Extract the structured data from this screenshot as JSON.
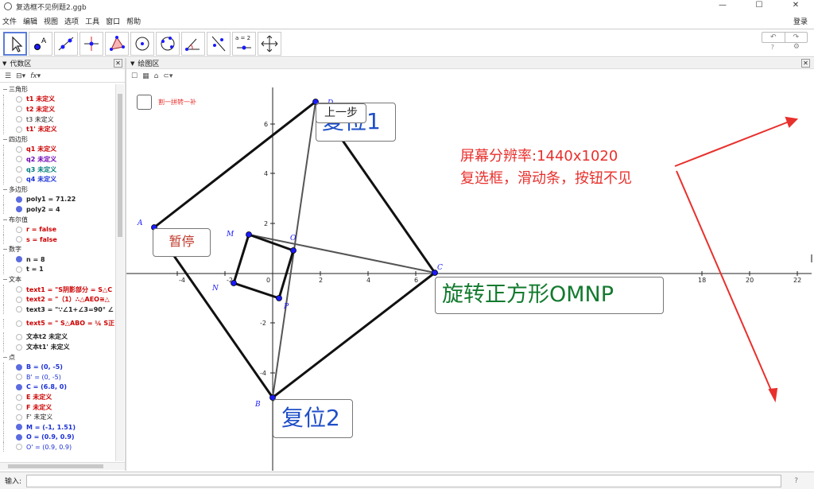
{
  "window": {
    "title": "复选框不见例题2.ggb",
    "minimize": "—",
    "maximize": "☐",
    "close": "✕"
  },
  "menu": [
    "文件",
    "编辑",
    "视图",
    "选项",
    "工具",
    "窗口",
    "帮助"
  ],
  "login": "登录",
  "toolbar": {
    "slider_tool_label": "a = 2",
    "undo": "↶",
    "redo": "↷"
  },
  "algebra": {
    "title": "代数区",
    "groups": [
      {
        "label": "三角形",
        "items": [
          {
            "text": "t1 未定义",
            "color": "red"
          },
          {
            "text": "t2 未定义",
            "color": "red"
          },
          {
            "text": "t3 未定义",
            "color": "dark"
          },
          {
            "text": "t1' 未定义",
            "color": "red"
          }
        ]
      },
      {
        "label": "四边形",
        "items": [
          {
            "text": "q1 未定义",
            "color": "red"
          },
          {
            "text": "q2 未定义",
            "color": "purple"
          },
          {
            "text": "q3 未定义",
            "color": "teal"
          },
          {
            "text": "q4 未定义",
            "color": "blue"
          }
        ]
      },
      {
        "label": "多边形",
        "items": [
          {
            "text": "poly1 = 71.22",
            "color": "dark",
            "on": true
          },
          {
            "text": "poly2 = 4",
            "color": "dark",
            "on": true
          }
        ]
      },
      {
        "label": "布尔值",
        "items": [
          {
            "text": "r = false",
            "color": "red"
          },
          {
            "text": "s = false",
            "color": "red"
          }
        ]
      },
      {
        "label": "数字",
        "items": [
          {
            "text": "n = 8",
            "color": "dark",
            "on": true
          },
          {
            "text": "t = 1",
            "color": "dark"
          }
        ]
      },
      {
        "label": "文本",
        "items": [
          {
            "text": "text1 = \"S阴影部分 = S△C",
            "color": "red",
            "tall": true
          },
          {
            "text": "text2 = \"（1）∴△AEO≅△",
            "color": "red"
          },
          {
            "text": "text3 = \"∵∠1+∠3=90°  ∠",
            "color": "dark"
          },
          {
            "text": "text5 = \" S△ABO = ¼ S正",
            "color": "red",
            "tall": true
          },
          {
            "text": "文本t2 未定义",
            "color": "dark"
          },
          {
            "text": "文本t1' 未定义",
            "color": "dark"
          }
        ]
      },
      {
        "label": "点",
        "items": [
          {
            "text": "B = (0, -5)",
            "color": "blue",
            "on": true
          },
          {
            "text": "B' = (0, -5)",
            "color": "blue"
          },
          {
            "text": "C = (6.8, 0)",
            "color": "blue",
            "on": true
          },
          {
            "text": "E 未定义",
            "color": "red"
          },
          {
            "text": "F 未定义",
            "color": "red"
          },
          {
            "text": "F' 未定义",
            "color": "dark"
          },
          {
            "text": "M = (-1, 1.51)",
            "color": "blue",
            "on": true
          },
          {
            "text": "O = (0.9, 0.9)",
            "color": "blue",
            "on": true
          },
          {
            "text": "O' = (0.9, 0.9)",
            "color": "blue"
          }
        ]
      }
    ]
  },
  "graphics": {
    "title": "绘图区",
    "checkbox_caption": "割一拼转一补",
    "buttons": {
      "prev_step": "上一步",
      "reset1": "复位1",
      "pause": "暂停",
      "reset2": "复位2",
      "rotate": "旋转正方形OMNP"
    },
    "annotation": [
      "屏幕分辨率:1440x1020",
      "复选框，滑动条，按钮不见"
    ],
    "x_ticks": [
      "-4",
      "-2",
      "0",
      "2",
      "4",
      "6",
      "18",
      "20",
      "22"
    ],
    "y_ticks": [
      "6",
      "4",
      "2",
      "-2",
      "-4"
    ],
    "point_labels": [
      "A",
      "B",
      "C",
      "D",
      "M",
      "N",
      "O",
      "P"
    ],
    "colors": {
      "point": "#1a1aff",
      "annotation": "#e8302c",
      "rotate_text": "#127a2e",
      "reset_text": "#1f4fc8"
    }
  },
  "input": {
    "label": "输入:",
    "help": "?"
  }
}
